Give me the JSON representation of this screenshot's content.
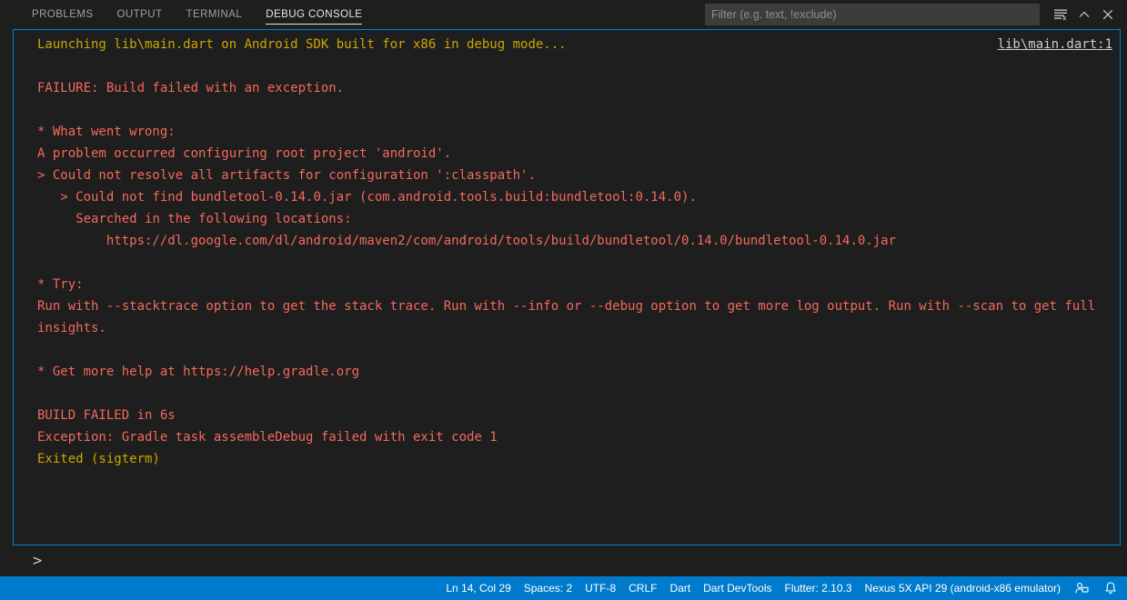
{
  "panel": {
    "tabs": [
      {
        "label": "PROBLEMS",
        "active": false
      },
      {
        "label": "OUTPUT",
        "active": false
      },
      {
        "label": "TERMINAL",
        "active": false
      },
      {
        "label": "DEBUG CONSOLE",
        "active": true
      }
    ],
    "filter": {
      "value": "",
      "placeholder": "Filter (e.g. text, !exclude)"
    },
    "actions": [
      {
        "name": "clear-console-icon",
        "title": "Clear Console"
      },
      {
        "name": "chevron-up-icon",
        "title": "Maximize Panel Size"
      },
      {
        "name": "close-icon",
        "title": "Close Panel"
      }
    ]
  },
  "console": {
    "source_link": "lib\\main.dart:1",
    "prompt": ">",
    "input_value": "",
    "lines": [
      {
        "text": "Launching lib\\main.dart on Android SDK built for x86 in debug mode...",
        "color": "warn"
      },
      {
        "text": "",
        "color": "plain"
      },
      {
        "text": "FAILURE: Build failed with an exception.",
        "color": "err"
      },
      {
        "text": "",
        "color": "plain"
      },
      {
        "text": "* What went wrong:",
        "color": "err"
      },
      {
        "text": "A problem occurred configuring root project 'android'.",
        "color": "err"
      },
      {
        "text": "> Could not resolve all artifacts for configuration ':classpath'.",
        "color": "err"
      },
      {
        "text": "   > Could not find bundletool-0.14.0.jar (com.android.tools.build:bundletool:0.14.0).",
        "color": "err"
      },
      {
        "text": "     Searched in the following locations:",
        "color": "err"
      },
      {
        "text": "         https://dl.google.com/dl/android/maven2/com/android/tools/build/bundletool/0.14.0/bundletool-0.14.0.jar",
        "color": "err"
      },
      {
        "text": "",
        "color": "plain"
      },
      {
        "text": "* Try:",
        "color": "err"
      },
      {
        "text": "Run with --stacktrace option to get the stack trace. Run with --info or --debug option to get more log output. Run with --scan to get full insights.",
        "color": "err"
      },
      {
        "text": "",
        "color": "plain"
      },
      {
        "text": "* Get more help at https://help.gradle.org",
        "color": "err"
      },
      {
        "text": "",
        "color": "plain"
      },
      {
        "text": "BUILD FAILED in 6s",
        "color": "err"
      },
      {
        "text": "Exception: Gradle task assembleDebug failed with exit code 1",
        "color": "err"
      },
      {
        "text": "Exited (sigterm)",
        "color": "warn"
      }
    ]
  },
  "statusbar": {
    "items": [
      {
        "label": "Ln 14, Col 29",
        "type": "text",
        "name": "status-cursor-position"
      },
      {
        "label": "Spaces: 2",
        "type": "text",
        "name": "status-indentation"
      },
      {
        "label": "UTF-8",
        "type": "text",
        "name": "status-encoding"
      },
      {
        "label": "CRLF",
        "type": "text",
        "name": "status-eol"
      },
      {
        "label": "Dart",
        "type": "text",
        "name": "status-language-mode"
      },
      {
        "label": "Dart DevTools",
        "type": "text",
        "name": "status-dart-devtools"
      },
      {
        "label": "Flutter: 2.10.3",
        "type": "text",
        "name": "status-flutter-version"
      },
      {
        "label": "Nexus 5X API 29 (android-x86 emulator)",
        "type": "text",
        "name": "status-device"
      },
      {
        "label": "",
        "type": "icon",
        "name": "remote-session-icon"
      },
      {
        "label": "",
        "type": "icon",
        "name": "bell-icon"
      }
    ]
  },
  "colors": {
    "accent": "#007acc",
    "focus_border": "#007fd4",
    "warn_text": "#cca700",
    "error_text": "#f4695c",
    "background": "#1e1e1e"
  }
}
